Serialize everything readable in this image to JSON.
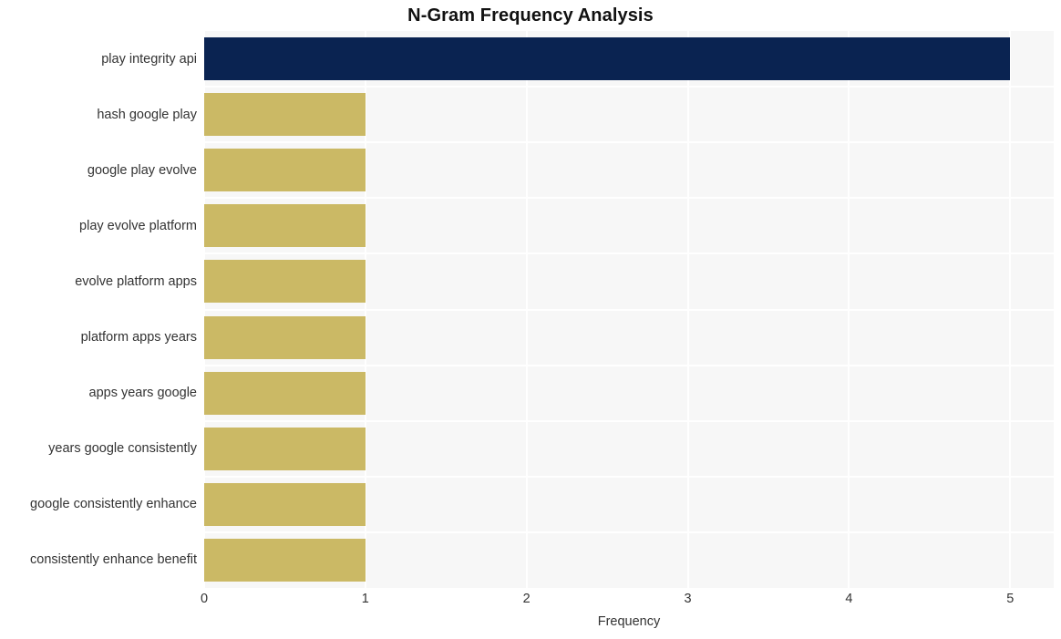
{
  "chart_data": {
    "type": "bar",
    "orientation": "horizontal",
    "title": "N-Gram Frequency Analysis",
    "xlabel": "Frequency",
    "ylabel": "",
    "categories": [
      "play integrity api",
      "hash google play",
      "google play evolve",
      "play evolve platform",
      "evolve platform apps",
      "platform apps years",
      "apps years google",
      "years google consistently",
      "google consistently enhance",
      "consistently enhance benefit"
    ],
    "values": [
      5,
      1,
      1,
      1,
      1,
      1,
      1,
      1,
      1,
      1
    ],
    "bar_colors": [
      "#0a2351",
      "#cbb965",
      "#cbb965",
      "#cbb965",
      "#cbb965",
      "#cbb965",
      "#cbb965",
      "#cbb965",
      "#cbb965",
      "#cbb965"
    ],
    "xlim": [
      0,
      5.27
    ],
    "xticks": [
      0,
      1,
      2,
      3,
      4,
      5
    ],
    "xtick_labels": [
      "0",
      "1",
      "2",
      "3",
      "4",
      "5"
    ],
    "grid": true,
    "grid_color": "#ffffff",
    "plot_background": "#f7f7f7",
    "figure_background": "#ffffff",
    "legend": null,
    "highlight_color": "#0a2351",
    "default_color": "#cbb965"
  }
}
